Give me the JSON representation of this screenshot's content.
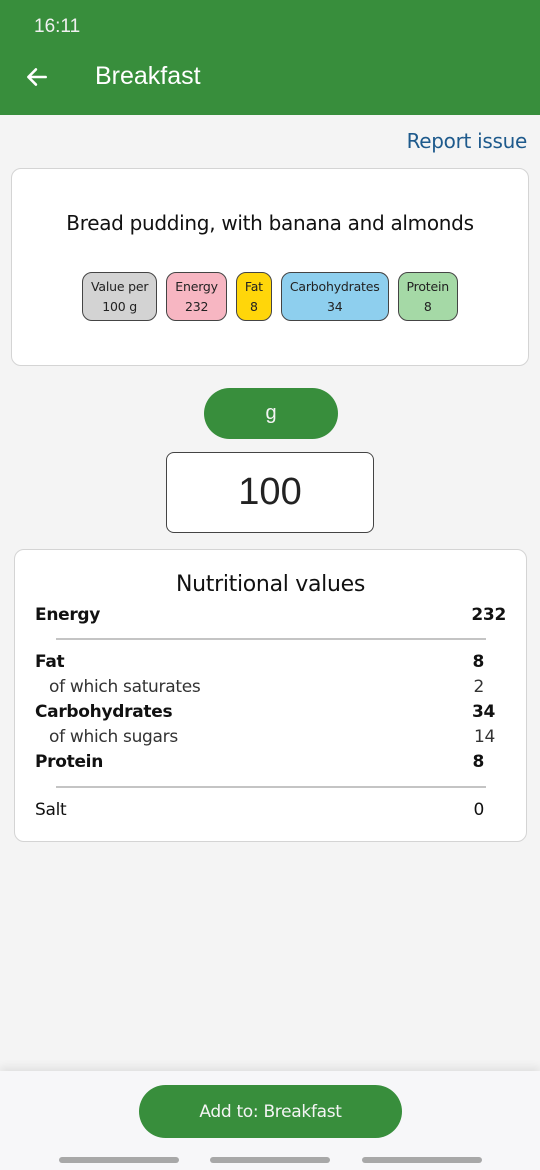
{
  "status_bar": {
    "time": "16:11"
  },
  "app_bar": {
    "title": "Breakfast",
    "back_icon": "arrow-left-icon"
  },
  "report_link": "Report issue",
  "food": {
    "name": "Bread pudding, with banana and almonds",
    "chips": [
      {
        "label": "Value per",
        "value": "100 g",
        "color": "#d3d3d3"
      },
      {
        "label": "Energy",
        "value": "232",
        "color": "#f7b6c2"
      },
      {
        "label": "Fat",
        "value": "8",
        "color": "#ffd60a"
      },
      {
        "label": "Carbohydrates",
        "value": "34",
        "color": "#8ecfee"
      },
      {
        "label": "Protein",
        "value": "8",
        "color": "#a5d9a6"
      }
    ]
  },
  "unit_selector": {
    "label": "g"
  },
  "quantity": {
    "value": "100"
  },
  "nutrition": {
    "title": "Nutritional values",
    "rows": [
      {
        "label": "Energy",
        "value": "232"
      },
      {
        "label": "Fat",
        "value": "8"
      },
      {
        "label": "of which saturates",
        "value": "2"
      },
      {
        "label": "Carbohydrates",
        "value": "34"
      },
      {
        "label": "of which sugars",
        "value": "14"
      },
      {
        "label": "Protein",
        "value": "8"
      },
      {
        "label": "Salt",
        "value": "0"
      }
    ]
  },
  "add_button": {
    "label": "Add to: Breakfast"
  },
  "colors": {
    "primary": "#388e3c",
    "link": "#1e5a8c"
  }
}
